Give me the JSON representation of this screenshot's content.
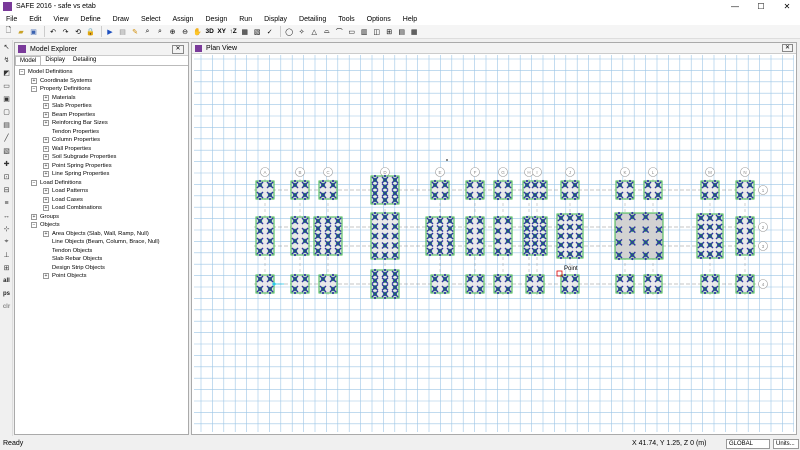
{
  "window": {
    "title": "SAFE 2016 - safe vs etab",
    "min": "—",
    "max": "☐",
    "close": "✕"
  },
  "menu": [
    "File",
    "Edit",
    "View",
    "Define",
    "Draw",
    "Select",
    "Assign",
    "Design",
    "Run",
    "Display",
    "Detailing",
    "Tools",
    "Options",
    "Help"
  ],
  "toolbar": {
    "icons": [
      "new-icon",
      "open-icon",
      "save-icon",
      "undo-icon",
      "redo-icon",
      "refresh-icon",
      "lock-icon",
      "run-icon",
      "pause-icon",
      "pencil-icon",
      "zoom-rubber-icon",
      "zoom-restore-icon",
      "zoom-in-icon",
      "zoom-out-icon",
      "pan-icon"
    ],
    "view_labels": [
      "3D",
      "XY",
      "↑Z"
    ],
    "more_icons": [
      "rubber-band-zoom-icon",
      "perspective-icon",
      "previous-view-icon",
      "check-icon",
      "circle-icon",
      "object-shrink-icon",
      "warning-icon",
      "slab-icon",
      "beam-icon",
      "column-icon",
      "wall-icon",
      "point-icon",
      "grid-icon",
      "table-icon"
    ]
  },
  "left_tools": [
    "pointer-icon",
    "reshape-icon",
    "draw-area-icon",
    "draw-rect-icon",
    "draw-slab-icon",
    "draw-opening-icon",
    "draw-beam-icon",
    "draw-column-icon",
    "draw-wall-icon",
    "draw-point-icon",
    "draw-strip-icon",
    "draw-tendon-icon",
    "draw-line-load-icon",
    "draw-dimension-icon",
    "snap-icon",
    "grid-icon",
    "all",
    "ps",
    "clr"
  ],
  "explorer": {
    "title": "Model Explorer",
    "tabs": [
      "Model",
      "Display",
      "Detailing"
    ],
    "tree": [
      {
        "label": "Model Definitions",
        "level": 0,
        "sign": "−"
      },
      {
        "label": "Coordinate Systems",
        "level": 1,
        "sign": "+"
      },
      {
        "label": "Property Definitions",
        "level": 1,
        "sign": "−"
      },
      {
        "label": "Materials",
        "level": 2,
        "sign": "+"
      },
      {
        "label": "Slab Properties",
        "level": 2,
        "sign": "+"
      },
      {
        "label": "Beam Properties",
        "level": 2,
        "sign": "+"
      },
      {
        "label": "Reinforcing Bar Sizes",
        "level": 2,
        "sign": "+"
      },
      {
        "label": "Tendon Properties",
        "level": 2,
        "sign": ""
      },
      {
        "label": "Column Properties",
        "level": 2,
        "sign": "+"
      },
      {
        "label": "Wall Properties",
        "level": 2,
        "sign": "+"
      },
      {
        "label": "Soil Subgrade Properties",
        "level": 2,
        "sign": "+"
      },
      {
        "label": "Point Spring Properties",
        "level": 2,
        "sign": "+"
      },
      {
        "label": "Line Spring Properties",
        "level": 2,
        "sign": "+"
      },
      {
        "label": "Load Definitions",
        "level": 1,
        "sign": "−"
      },
      {
        "label": "Load Patterns",
        "level": 2,
        "sign": "+"
      },
      {
        "label": "Load Cases",
        "level": 2,
        "sign": "+"
      },
      {
        "label": "Load Combinations",
        "level": 2,
        "sign": "+"
      },
      {
        "label": "Groups",
        "level": 1,
        "sign": "+"
      },
      {
        "label": "Objects",
        "level": 1,
        "sign": "−"
      },
      {
        "label": "Area Objects (Slab, Wall, Ramp, Null)",
        "level": 2,
        "sign": "+"
      },
      {
        "label": "Line Objects (Beam, Column, Brace, Null)",
        "level": 2,
        "sign": ""
      },
      {
        "label": "Tendon Objects",
        "level": 2,
        "sign": ""
      },
      {
        "label": "Slab Rebar Objects",
        "level": 2,
        "sign": ""
      },
      {
        "label": "Design Strip Objects",
        "level": 2,
        "sign": ""
      },
      {
        "label": "Point Objects",
        "level": 2,
        "sign": "+"
      }
    ]
  },
  "plan": {
    "title": "Plan View",
    "grid_x_labels": [
      "A",
      "B",
      "C",
      "D",
      "E",
      "F",
      "G",
      "H",
      "I",
      "J",
      "K",
      "L",
      "M",
      "N",
      "O"
    ],
    "grid_y_labels": [
      "1",
      "2",
      "3",
      "4"
    ],
    "tooltip": "Point",
    "colors": {
      "grid": "#9cc6e6",
      "pile": "#2f3a9e",
      "pile_fill": "#22b14c",
      "outline": "#3cb44b",
      "cap": "#c8c8c8"
    }
  },
  "status": {
    "left": "Ready",
    "coords": "X 41.74,  Y 1.25,  Z 0   (m)",
    "coord_system": "GLOBAL",
    "units": "Units..."
  }
}
